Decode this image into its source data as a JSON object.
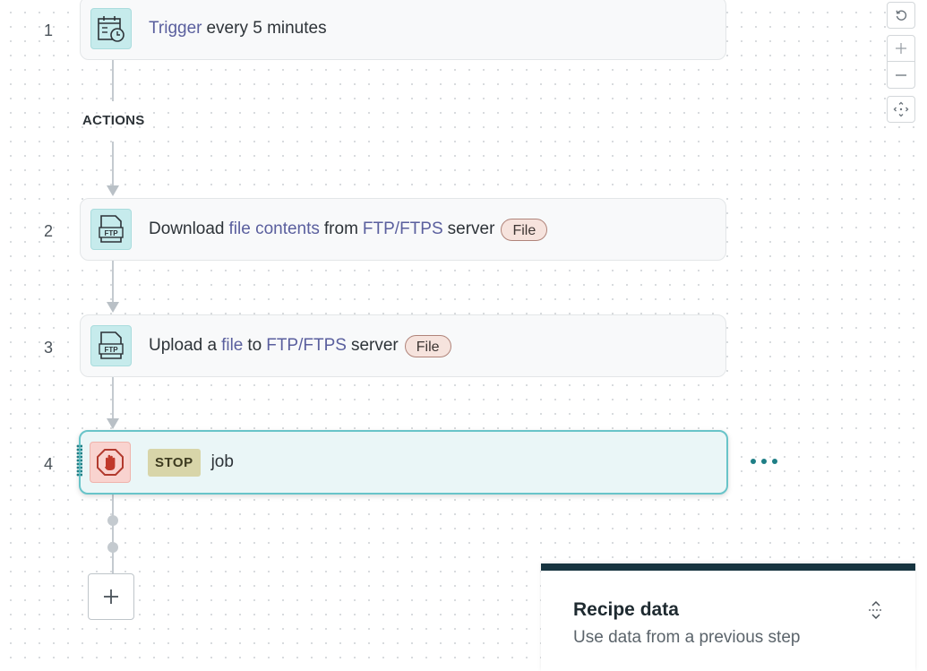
{
  "steps": [
    {
      "num": "1",
      "segments": [
        {
          "t": "Trigger",
          "hl": true
        },
        {
          "t": "every 5 minutes",
          "hl": false
        }
      ],
      "icon": "calendar-clock-icon"
    },
    {
      "num": "2",
      "segments": [
        {
          "t": "Download",
          "hl": false
        },
        {
          "t": "file contents",
          "hl": true
        },
        {
          "t": "from",
          "hl": false
        },
        {
          "t": "FTP/FTPS",
          "hl": true
        },
        {
          "t": "server",
          "hl": false
        }
      ],
      "pill": "File",
      "icon": "ftp-icon"
    },
    {
      "num": "3",
      "segments": [
        {
          "t": "Upload a",
          "hl": false
        },
        {
          "t": "file",
          "hl": true
        },
        {
          "t": "to",
          "hl": false
        },
        {
          "t": "FTP/FTPS",
          "hl": true
        },
        {
          "t": "server",
          "hl": false
        }
      ],
      "pill": "File",
      "icon": "ftp-icon"
    },
    {
      "num": "4",
      "badge": "STOP",
      "text": "job",
      "icon": "stop-hand-icon"
    }
  ],
  "ftp_icon_text": "FTP",
  "actions_label": "ACTIONS",
  "recipe_panel": {
    "title": "Recipe data",
    "subtitle": "Use data from a previous step"
  },
  "colors": {
    "accent_teal": "#1f7f86",
    "highlight_text": "#5a5f9e",
    "panel_header": "#173440"
  }
}
